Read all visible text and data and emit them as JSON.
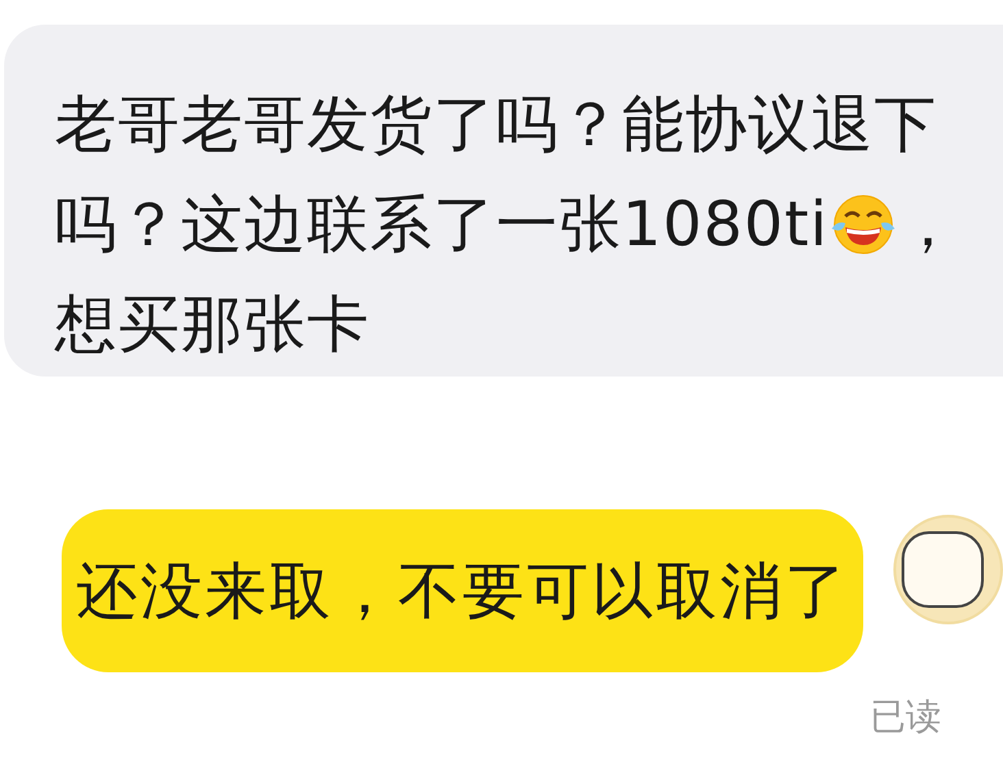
{
  "messages": [
    {
      "kind": "received",
      "lines": [
        [
          {
            "kind": "text",
            "text": "老哥老哥发货了吗？能协议退下"
          }
        ],
        [
          {
            "kind": "text",
            "text": "吗？这边联系了一张1080ti"
          },
          {
            "kind": "emoji"
          },
          {
            "kind": "text",
            "text": "，"
          }
        ],
        [
          {
            "kind": "text",
            "text": "想买那张卡"
          }
        ]
      ]
    },
    {
      "kind": "sent",
      "text": "还没来取，不要可以取消了",
      "status": "已读"
    }
  ]
}
